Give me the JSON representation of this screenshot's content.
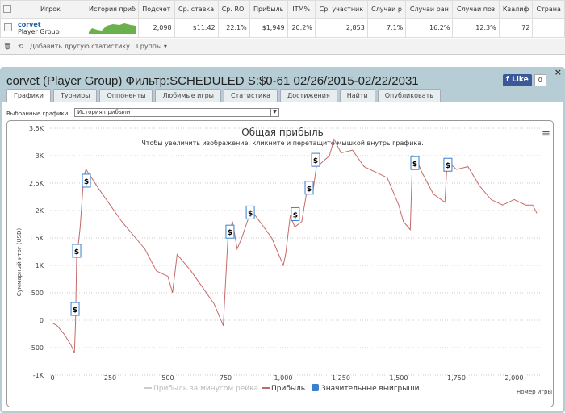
{
  "table": {
    "headers": [
      "Игрок",
      "История приб",
      "Подсчет",
      "Ср. ставка",
      "Ср. ROI",
      "Прибыль",
      "ITM%",
      "Ср. участник",
      "Случаи р",
      "Случаи ран",
      "Случаи поз",
      "Квалиф",
      "Страна"
    ],
    "row": {
      "name": "corvet",
      "group": "Player Group",
      "values": [
        "2,098",
        "$11.42",
        "22.1%",
        "$1,949",
        "20.2%",
        "2,853",
        "7.1%",
        "16.2%",
        "12.3%",
        "72",
        ""
      ]
    }
  },
  "toolbar": {
    "add_stat": "Добавить другую статистику",
    "groups": "Группы"
  },
  "panel": {
    "title": "corvet (Player Group) Фильтр:SCHEDULED S:$0-61 02/26/2015-02/22/2031",
    "like": "Like",
    "like_count": "0",
    "close": "×",
    "tabs": [
      "Графики",
      "Турниры",
      "Оппоненты",
      "Любимые игры",
      "Статистика",
      "Достижения",
      "Найти",
      "Опубликовать"
    ],
    "selected_label": "Выбранные графики:",
    "selected_value": "История прибыли"
  },
  "chart_data": {
    "type": "line",
    "title": "Общая прибыль",
    "subtitle": "Чтобы увеличить изображение, кликните и перетащите мышкой внутрь графика.",
    "xlabel": "Номер игры",
    "ylabel": "Суммарный итог (USD)",
    "xlim": [
      0,
      2100
    ],
    "ylim": [
      -1000,
      3500
    ],
    "xticks": [
      0,
      250,
      500,
      750,
      1000,
      1250,
      1500,
      1750,
      2000
    ],
    "xtick_labels": [
      "0",
      "250",
      "500",
      "750",
      "1,000",
      "1,250",
      "1,500",
      "1,750",
      "2,000"
    ],
    "yticks": [
      -1000,
      -500,
      0,
      500,
      1000,
      1500,
      2000,
      2500,
      3000,
      3500
    ],
    "ytick_labels": [
      "-1K",
      "-500",
      "0",
      "500",
      "1K",
      "1.5K",
      "2K",
      "2.5K",
      "3K",
      "3.5K"
    ],
    "legend": [
      "Прибыль за минусом рейка",
      "Прибыль",
      "Значительные выигрыши"
    ],
    "legend_position": "bottom",
    "series": [
      {
        "name": "Прибыль",
        "color": "#c46a6a",
        "points": [
          [
            0,
            -50
          ],
          [
            20,
            -100
          ],
          [
            50,
            -250
          ],
          [
            80,
            -450
          ],
          [
            95,
            -600
          ],
          [
            100,
            -50
          ],
          [
            105,
            1200
          ],
          [
            110,
            1300
          ],
          [
            120,
            1700
          ],
          [
            135,
            2600
          ],
          [
            145,
            2750
          ],
          [
            200,
            2400
          ],
          [
            300,
            1800
          ],
          [
            400,
            1300
          ],
          [
            450,
            900
          ],
          [
            500,
            800
          ],
          [
            520,
            500
          ],
          [
            540,
            1200
          ],
          [
            600,
            900
          ],
          [
            650,
            600
          ],
          [
            700,
            300
          ],
          [
            740,
            -100
          ],
          [
            760,
            1500
          ],
          [
            780,
            1800
          ],
          [
            800,
            1300
          ],
          [
            820,
            1500
          ],
          [
            860,
            2000
          ],
          [
            880,
            1900
          ],
          [
            950,
            1500
          ],
          [
            1000,
            1000
          ],
          [
            1010,
            1200
          ],
          [
            1030,
            1900
          ],
          [
            1050,
            1700
          ],
          [
            1080,
            1800
          ],
          [
            1100,
            2300
          ],
          [
            1130,
            2400
          ],
          [
            1140,
            2700
          ],
          [
            1150,
            3000
          ],
          [
            1160,
            2850
          ],
          [
            1200,
            3000
          ],
          [
            1220,
            3300
          ],
          [
            1250,
            3050
          ],
          [
            1300,
            3100
          ],
          [
            1350,
            2800
          ],
          [
            1400,
            2700
          ],
          [
            1450,
            2600
          ],
          [
            1500,
            2100
          ],
          [
            1520,
            1800
          ],
          [
            1550,
            1650
          ],
          [
            1560,
            3000
          ],
          [
            1580,
            2900
          ],
          [
            1600,
            2700
          ],
          [
            1650,
            2300
          ],
          [
            1700,
            2150
          ],
          [
            1710,
            2900
          ],
          [
            1750,
            2750
          ],
          [
            1800,
            2800
          ],
          [
            1850,
            2450
          ],
          [
            1900,
            2200
          ],
          [
            1950,
            2100
          ],
          [
            2000,
            2200
          ],
          [
            2050,
            2100
          ],
          [
            2080,
            2100
          ],
          [
            2098,
            1950
          ]
        ]
      }
    ],
    "markers": {
      "label": "$",
      "points": [
        [
          98,
          190
        ],
        [
          105,
          1250
        ],
        [
          147,
          2530
        ],
        [
          769,
          1600
        ],
        [
          857,
          1950
        ],
        [
          1052,
          1920
        ],
        [
          1112,
          2400
        ],
        [
          1140,
          2910
        ],
        [
          1570,
          2850
        ],
        [
          1713,
          2820
        ]
      ]
    }
  }
}
